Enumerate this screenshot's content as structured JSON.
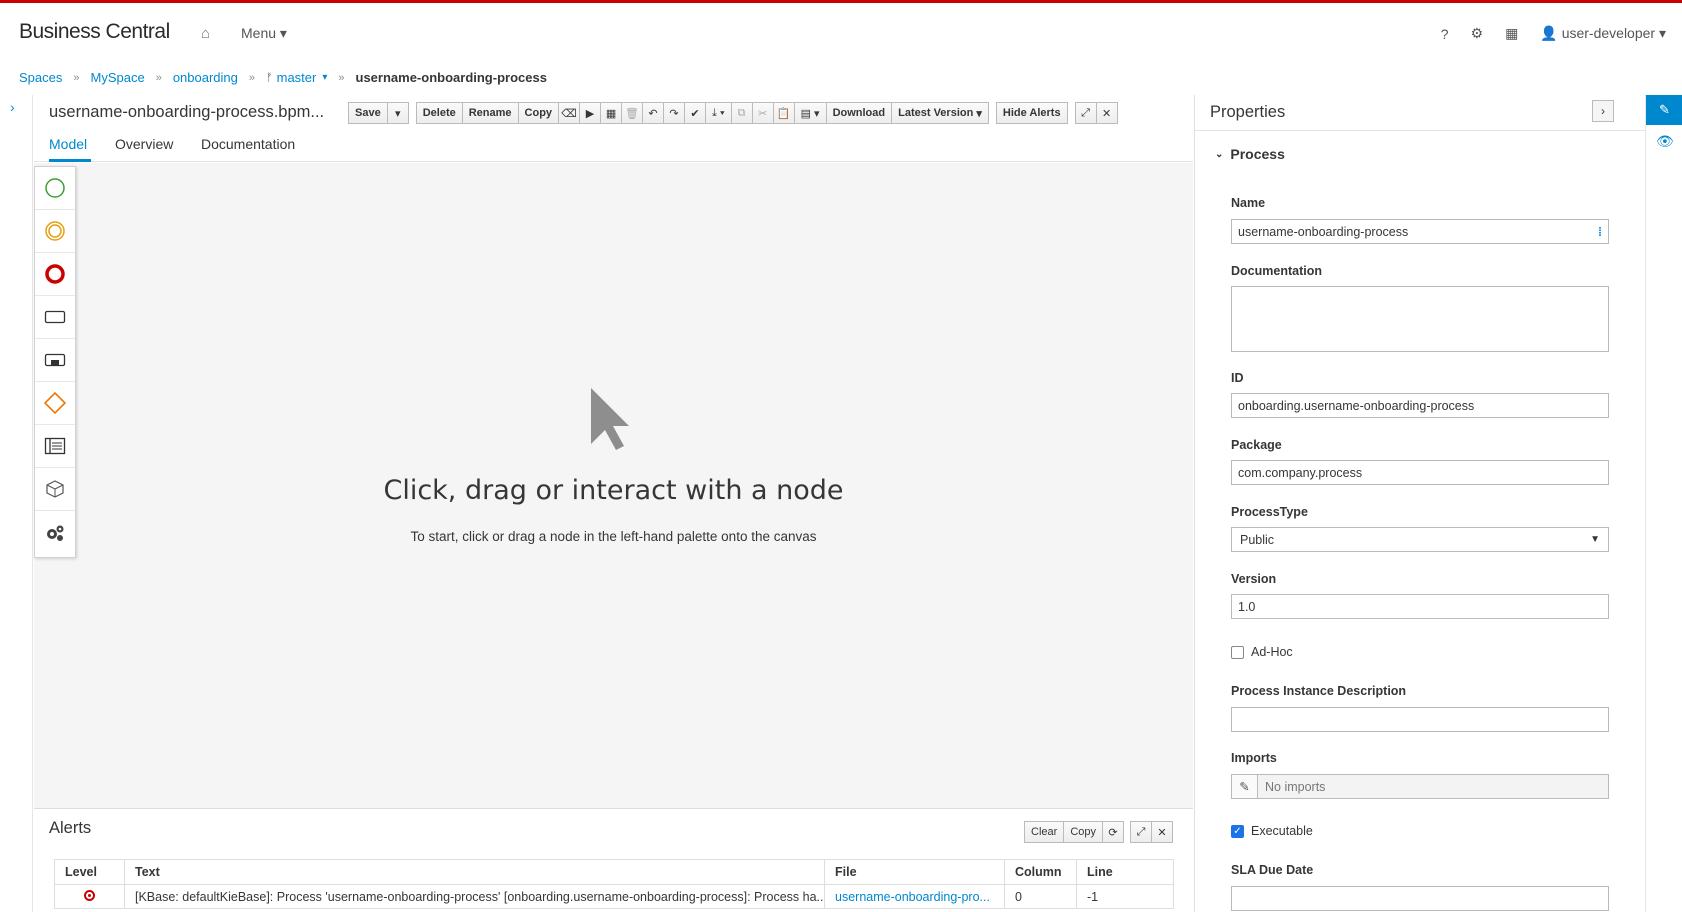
{
  "header": {
    "brand": "Business Central",
    "menu_label": "Menu",
    "user_label": "user-developer"
  },
  "breadcrumb": {
    "items": [
      "Spaces",
      "MySpace",
      "onboarding",
      "master"
    ],
    "current": "username-onboarding-process"
  },
  "editor": {
    "file_title": "username-onboarding-process.bpm...",
    "toolbar": {
      "save": "Save",
      "delete": "Delete",
      "rename": "Rename",
      "copy": "Copy",
      "download": "Download",
      "latest_version": "Latest Version",
      "hide_alerts": "Hide Alerts"
    },
    "tabs": [
      "Model",
      "Overview",
      "Documentation"
    ],
    "active_tab": "Model",
    "canvas_title": "Click, drag or interact with a node",
    "canvas_subtitle": "To start, click or drag a node in the left-hand palette onto the canvas",
    "palette": [
      {
        "icon": "start-event-icon",
        "color": "#3f9c35"
      },
      {
        "icon": "intermediate-event-icon",
        "color": "#e5a00d"
      },
      {
        "icon": "end-event-icon",
        "color": "#cc0000"
      },
      {
        "icon": "task-icon",
        "color": "#333333"
      },
      {
        "icon": "subprocess-icon",
        "color": "#333333"
      },
      {
        "icon": "gateway-icon",
        "color": "#ec7a08"
      },
      {
        "icon": "lane-icon",
        "color": "#333333"
      },
      {
        "icon": "artifact-icon",
        "color": "#333333"
      },
      {
        "icon": "custom-tasks-icon",
        "color": "#333333"
      }
    ]
  },
  "alerts": {
    "title": "Alerts",
    "clear": "Clear",
    "copy": "Copy",
    "columns": [
      "Level",
      "Text",
      "File",
      "Column",
      "Line"
    ],
    "rows": [
      {
        "text": "[KBase: defaultKieBase]: Process 'username-onboarding-process' [onboarding.username-onboarding-process]: Process ha...",
        "file": "username-onboarding-pro...",
        "column": "0",
        "line": "-1"
      }
    ]
  },
  "properties": {
    "title": "Properties",
    "section": "Process",
    "name_label": "Name",
    "name_value": "username-onboarding-process",
    "documentation_label": "Documentation",
    "id_label": "ID",
    "id_value": "onboarding.username-onboarding-process",
    "package_label": "Package",
    "package_value": "com.company.process",
    "process_type_label": "ProcessType",
    "process_type_value": "Public",
    "version_label": "Version",
    "version_value": "1.0",
    "adhoc_label": "Ad-Hoc",
    "adhoc_checked": false,
    "instance_desc_label": "Process Instance Description",
    "imports_label": "Imports",
    "imports_value": "No imports",
    "executable_label": "Executable",
    "executable_checked": true,
    "sla_label": "SLA Due Date"
  }
}
